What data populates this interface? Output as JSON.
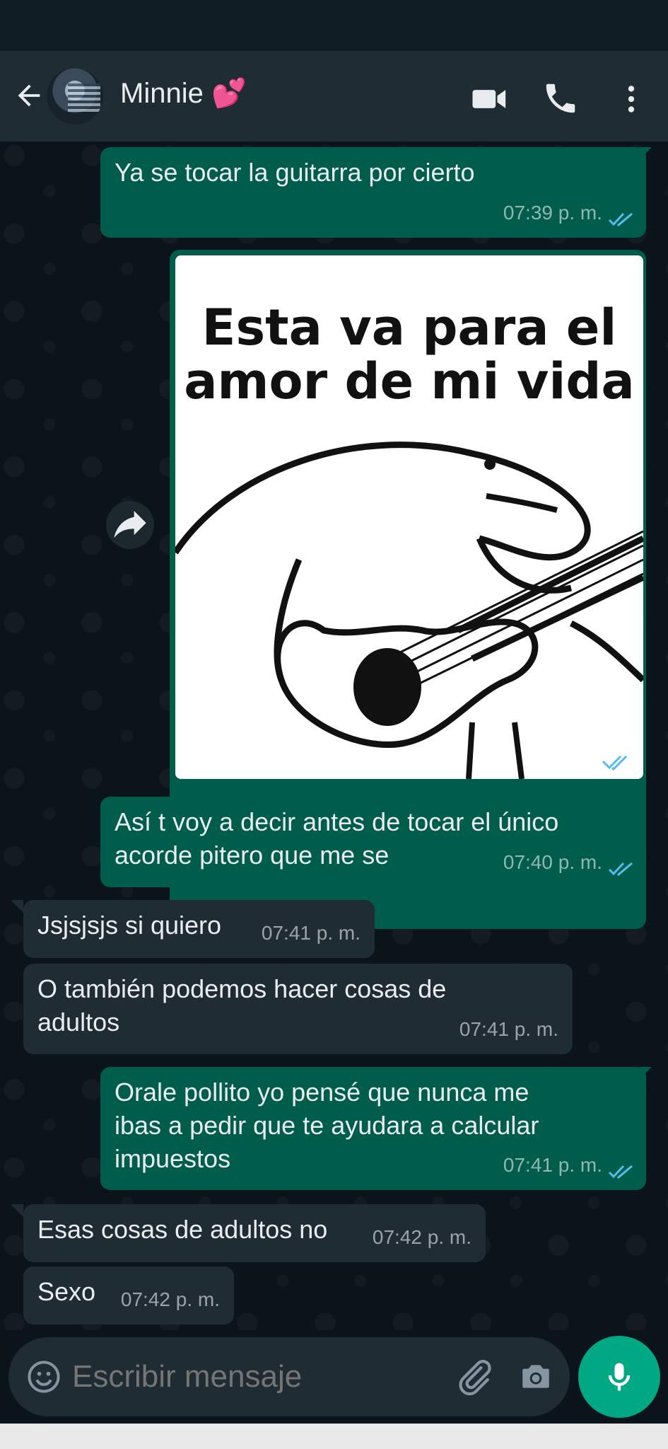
{
  "contact": {
    "name": "Minnie 💕"
  },
  "colors": {
    "header_bg": "#1f2c34",
    "chat_bg": "#0b141a",
    "outgoing_bubble": "#005c4b",
    "incoming_bubble": "#202c33",
    "read_ticks": "#53bdeb",
    "accent": "#00a884"
  },
  "icons": {
    "back": "arrow-left-icon",
    "video": "video-camera-icon",
    "call": "phone-icon",
    "menu": "more-vertical-icon",
    "emoji": "emoji-icon",
    "attach": "paperclip-icon",
    "camera": "camera-icon",
    "mic": "microphone-icon",
    "forward": "forward-icon",
    "read": "double-check-icon"
  },
  "messages": [
    {
      "direction": "out",
      "text": "Ya se tocar la guitarra por cierto",
      "time": "07:39 p. m.",
      "status": "read"
    },
    {
      "direction": "out",
      "type": "image",
      "image_text": [
        "Esta va para el",
        "amor de mi vida"
      ],
      "status": "read"
    },
    {
      "direction": "out",
      "text_lines": [
        "Así t voy a decir antes de tocar el único",
        "acorde pitero que me se"
      ],
      "time": "07:40 p. m.",
      "status": "read"
    },
    {
      "direction": "in",
      "text": "Jsjsjsjs si quiero",
      "time": "07:41 p. m."
    },
    {
      "direction": "in",
      "text_lines": [
        "O también podemos hacer cosas de",
        "adultos"
      ],
      "time": "07:41 p. m."
    },
    {
      "direction": "out",
      "text_lines": [
        "Orale pollito yo pensé que nunca me",
        "ibas a pedir que te ayudara a calcular",
        "impuestos"
      ],
      "time": "07:41 p. m.",
      "status": "read"
    },
    {
      "direction": "in",
      "text": "Esas cosas de adultos no",
      "time": "07:42 p. m."
    },
    {
      "direction": "in",
      "text": "Sexo",
      "time": "07:42 p. m."
    }
  ],
  "composer": {
    "placeholder": "Escribir mensaje"
  }
}
